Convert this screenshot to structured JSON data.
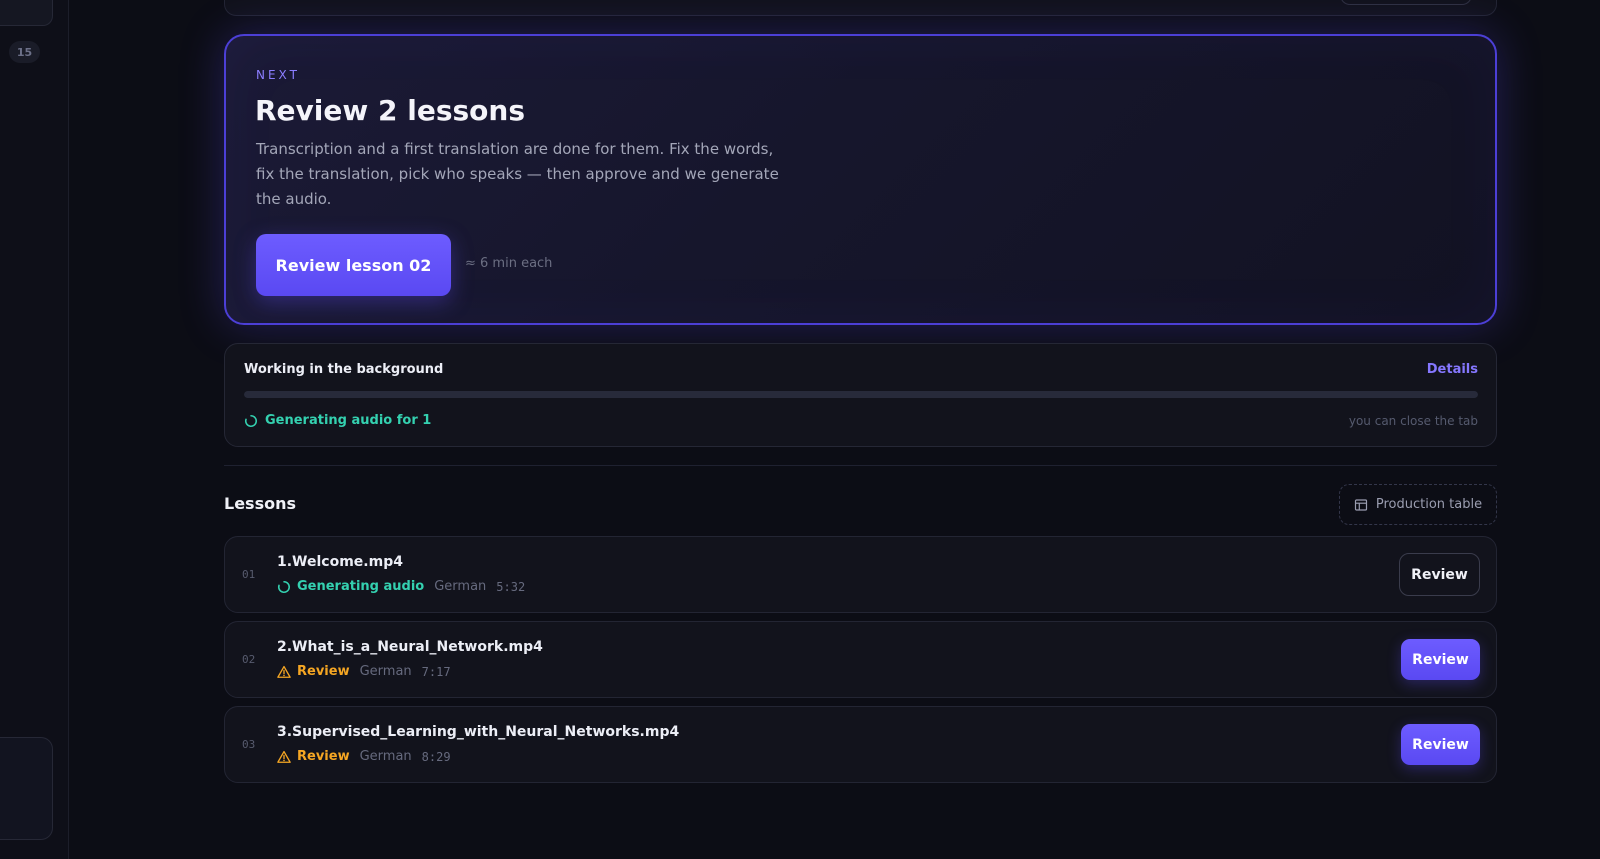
{
  "sidebar": {
    "badge": "15"
  },
  "hero": {
    "eyebrow": "NEXT",
    "title": "Review 2 lessons",
    "description": "Transcription and a first translation are done for them. Fix the words, fix the translation, pick who speaks — then approve and we generate the audio.",
    "cta_label": "Review lesson 02",
    "hint": "≈ 6 min each",
    "accent": "#6d5cff"
  },
  "background": {
    "title": "Working in the background",
    "details_label": "Details",
    "status": "Generating audio for 1",
    "note": "you can close the tab",
    "status_color": "#34d1b0"
  },
  "lessons": {
    "title": "Lessons",
    "production_table_label": "Production table",
    "items": [
      {
        "num": "01",
        "name": "1.Welcome.mp4",
        "status": "Generating audio",
        "language": "German",
        "duration": "5:32",
        "action": "Review"
      },
      {
        "num": "02",
        "name": "2.What_is_a_Neural_Network.mp4",
        "status": "Review",
        "language": "German",
        "duration": "7:17",
        "action": "Review"
      },
      {
        "num": "03",
        "name": "3.Supervised_Learning_with_Neural_Networks.mp4",
        "status": "Review",
        "language": "German",
        "duration": "8:29",
        "action": "Review"
      }
    ]
  },
  "colors": {
    "review_status": "#f5a623",
    "generating_status": "#34d1b0"
  },
  "icons": [
    "spinner-icon",
    "warning-icon",
    "table-icon"
  ]
}
